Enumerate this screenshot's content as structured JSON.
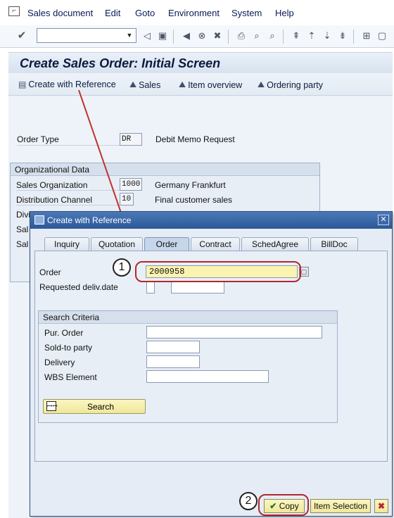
{
  "menu": {
    "items": [
      "Sales document",
      "Edit",
      "Goto",
      "Environment",
      "System",
      "Help"
    ]
  },
  "toolbar": {
    "command_value": "",
    "icons": [
      "enter-icon",
      "back-icon",
      "save-icon",
      "back-nav-icon",
      "exit-icon",
      "cancel-icon",
      "print-icon",
      "find-icon",
      "find-next-icon",
      "first-page-icon",
      "prev-page-icon",
      "next-page-icon",
      "last-page-icon",
      "create-session-icon",
      "help-icon"
    ]
  },
  "header": {
    "title": "Create Sales Order: Initial Screen"
  },
  "app_toolbar": {
    "create_with_reference": "Create with Reference",
    "sales": "Sales",
    "item_overview": "Item overview",
    "ordering_party": "Ordering party"
  },
  "main": {
    "order_type_label": "Order Type",
    "order_type_value": "DR",
    "order_type_desc": "Debit Memo Request",
    "org_group_title": "Organizational Data",
    "sales_org_label": "Sales Organization",
    "sales_org_value": "1000",
    "sales_org_desc": "Germany Frankfurt",
    "dist_channel_label": "Distribution Channel",
    "dist_channel_value": "10",
    "dist_channel_desc": "Final customer sales",
    "division_label": "Divi",
    "sales_office_label": "Sal",
    "sales_group_label": "Sal"
  },
  "dialog": {
    "title": "Create with Reference",
    "tabs": [
      "Inquiry",
      "Quotation",
      "Order",
      "Contract",
      "SchedAgree",
      "BillDoc"
    ],
    "active_tab": "Order",
    "order_label": "Order",
    "order_value": "2000958",
    "req_deliv_label": "Requested deliv.date",
    "search_group_title": "Search Criteria",
    "pur_order_label": "Pur. Order",
    "sold_to_label": "Sold-to party",
    "delivery_label": "Delivery",
    "wbs_label": "WBS Element",
    "search_button": "Search",
    "copy_button": "Copy",
    "item_selection_button": "Item Selection"
  },
  "annotations": {
    "step1": "1",
    "step2": "2",
    "callout_color": "#b3282d"
  }
}
